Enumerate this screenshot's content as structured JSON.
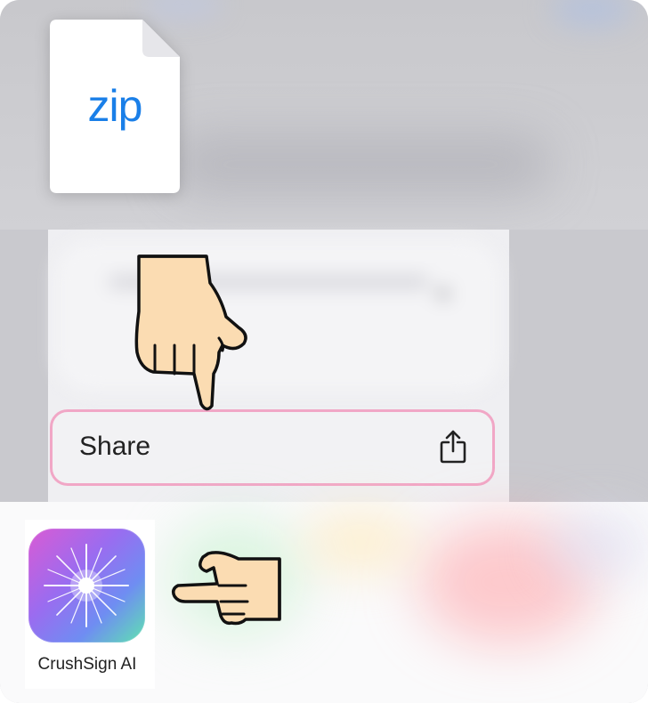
{
  "file": {
    "extension_label": "zip",
    "icon": "zip-document-icon",
    "accent_color": "#1a7fe8"
  },
  "context_menu": {
    "share_label": "Share",
    "share_icon": "share-icon",
    "highlight_color": "#f1a7c6"
  },
  "share_sheet": {
    "apps": [
      {
        "name": "CrushSign AI",
        "icon": "sparkle-app-icon"
      }
    ]
  },
  "annotations": {
    "pointer_down_icon": "pointing-hand-down-icon",
    "pointer_left_icon": "pointing-hand-left-icon",
    "hand_color": "#fbdcb2"
  }
}
